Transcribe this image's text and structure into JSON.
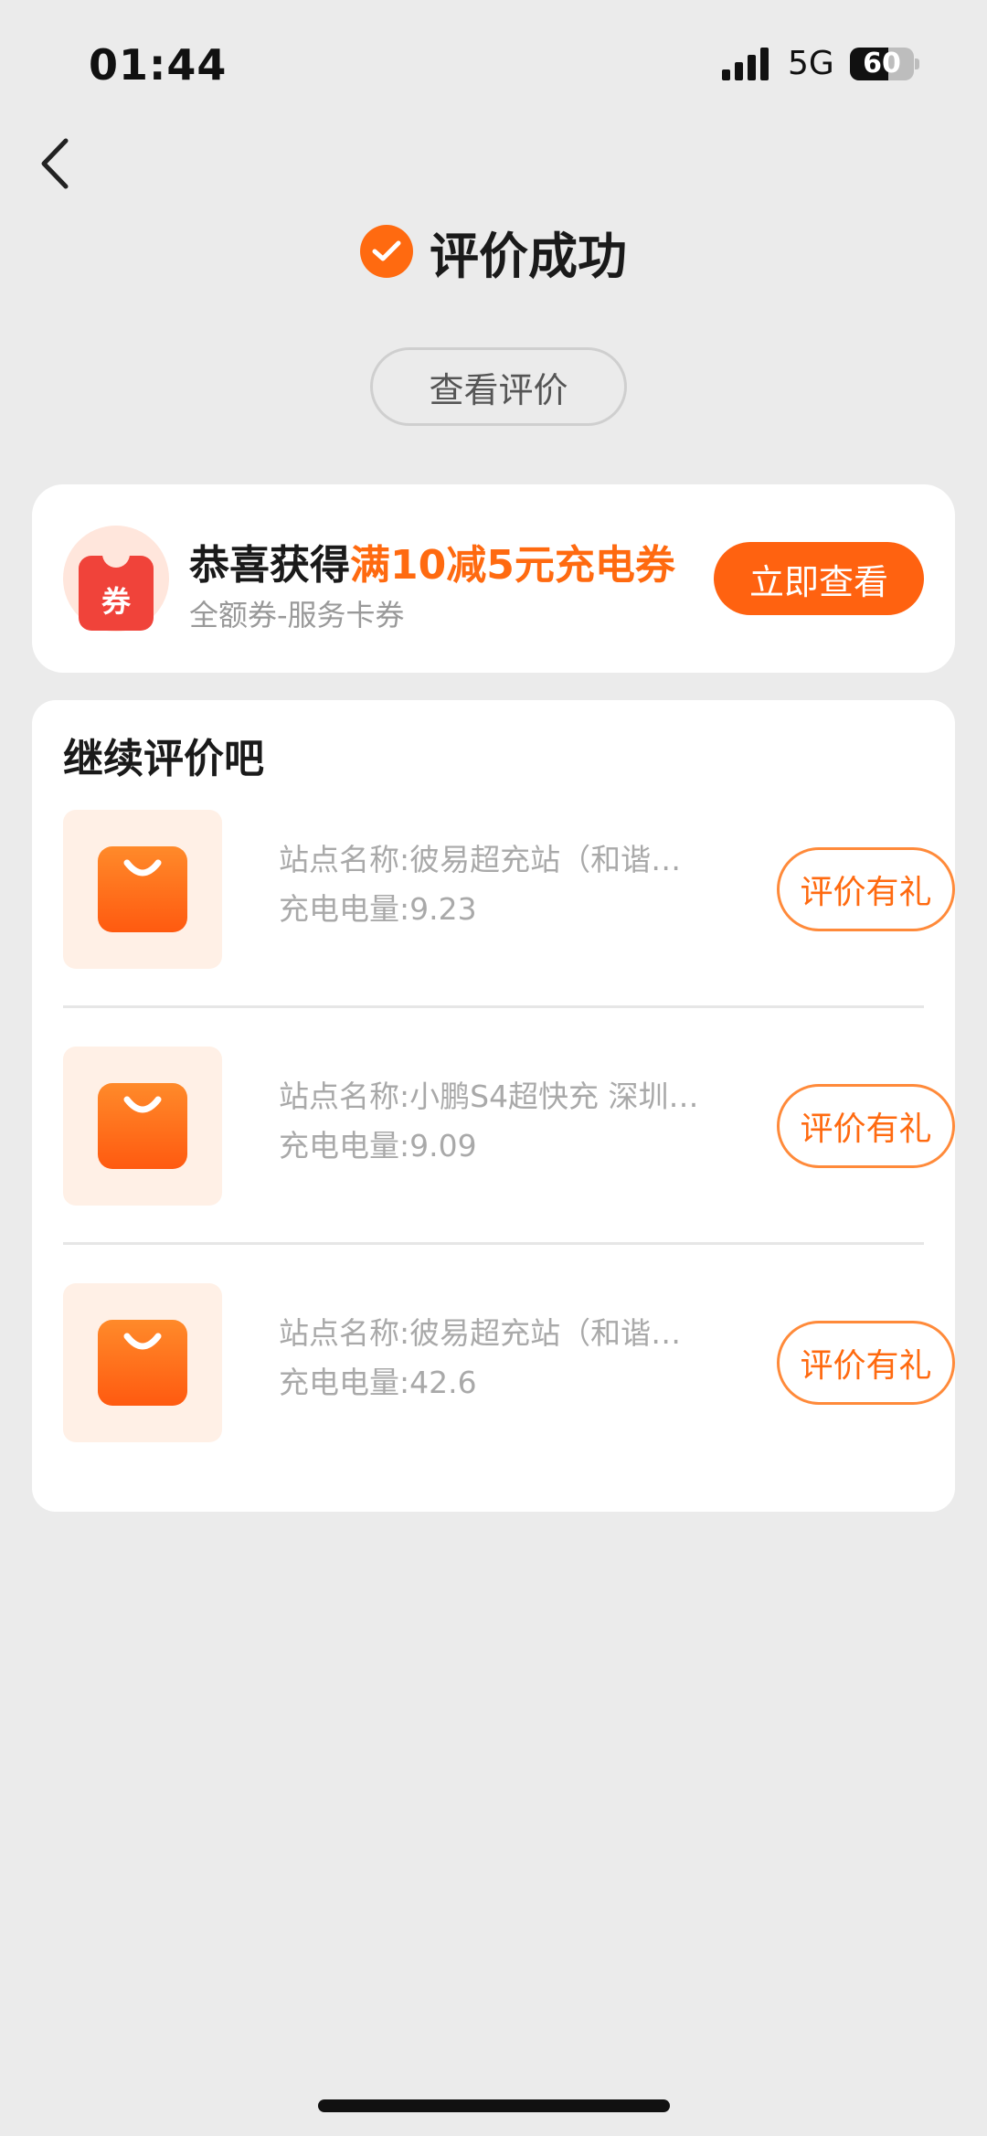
{
  "status_bar": {
    "time": "01:44",
    "network": "5G",
    "battery_percent": "60",
    "battery_level": 0.6
  },
  "header": {
    "title": "评价成功",
    "view_review_label": "查看评价"
  },
  "coupon": {
    "icon_char": "券",
    "text_prefix": "恭喜获得",
    "text_highlight": "满10减5元充电券",
    "subtitle": "全额券-服务卡券",
    "action_label": "立即查看"
  },
  "continue_section": {
    "title": "继续评价吧",
    "items": [
      {
        "site": "站点名称:彼易超充站（和谐…",
        "power": "充电电量:9.23",
        "action_label": "评价有礼"
      },
      {
        "site": "站点名称:小鹏S4超快充 深圳…",
        "power": "充电电量:9.09",
        "action_label": "评价有礼"
      },
      {
        "site": "站点名称:彼易超充站（和谐…",
        "power": "充电电量:42.6",
        "action_label": "评价有礼"
      }
    ]
  },
  "icons": {
    "back": "chevron-left-icon",
    "success": "check-circle-icon",
    "coupon": "coupon-icon",
    "order": "shopping-bag-icon"
  },
  "colors": {
    "accent": "#ff6a10",
    "coupon_red": "#f0433a",
    "background": "#ebebeb"
  }
}
